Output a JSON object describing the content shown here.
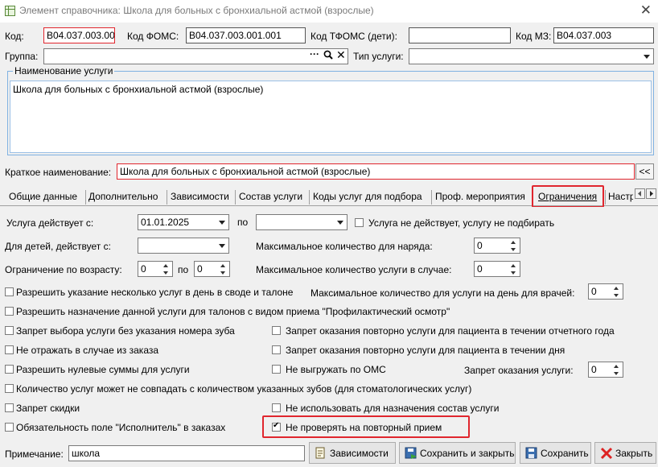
{
  "window": {
    "title": "Элемент справочника: Школа для больных с бронхиальной астмой (взрослые)"
  },
  "header": {
    "kod_label": "Код:",
    "kod_value": "B04.037.003.00",
    "foms_label": "Код ФОМС:",
    "foms_value": "B04.037.003.001.001",
    "tfoms_label": "Код ТФОМС (дети):",
    "tfoms_value": "",
    "mz_label": "Код МЗ:",
    "mz_value": "B04.037.003",
    "group_label": "Группа:",
    "group_value": "",
    "service_type_label": "Тип услуги:",
    "service_type_value": ""
  },
  "name_section": {
    "legend": "Наименование услуги",
    "value": "Школа для больных с бронхиальной астмой (взрослые)",
    "short_label": "Краткое наименование:",
    "short_value": "Школа для больных с бронхиальной астмой (взрослые)",
    "copy_button": "<<"
  },
  "tabs": [
    {
      "label": "Общие данные"
    },
    {
      "label": "Дополнительно"
    },
    {
      "label": "Зависимости"
    },
    {
      "label": "Состав услуги"
    },
    {
      "label": "Коды услуг для подбора"
    },
    {
      "label": "Проф. мероприятия"
    },
    {
      "label": "Ограничения"
    },
    {
      "label": "Настр"
    }
  ],
  "restrictions": {
    "valid_from_label": "Услуга действует с:",
    "valid_from_value": "01.01.2025",
    "valid_to_label": "по",
    "valid_to_value": "",
    "inactive_label": "Услуга не действует, услугу не подбирать",
    "children_from_label": "Для детей, действует с:",
    "children_from_value": "",
    "max_order_label": "Максимальное количество для наряда:",
    "max_order_value": "0",
    "age_label": "Ограничение по возрасту:",
    "age_from": "0",
    "age_to_label": "по",
    "age_to": "0",
    "max_case_label": "Максимальное количество услуги в случае:",
    "max_case_value": "0",
    "multi_per_day_label": "Разрешить указание несколько услуг в день в своде и талоне",
    "max_per_day_label": "Максимальное количество для услуги на день для врачей:",
    "max_per_day_value": "0",
    "allow_prof_label": "Разрешить назначение данной услуги для талонов с видом приема \"Профилактический осмотр\"",
    "no_tooth_label": "Запрет выбора услуги без указания номера зуба",
    "repeat_year_label": "Запрет оказания повторно услуги для пациента в течении отчетного года",
    "no_case_from_order_label": "Не отражать в случае из заказа",
    "repeat_day_label": "Запрет оказания повторно услуги для пациента в течении дня",
    "allow_zero_label": "Разрешить нулевые суммы для услуги",
    "no_oms_label": "Не выгружать по ОМС",
    "ban_label": "Запрет оказания услуги:",
    "ban_value": "0",
    "tooth_mismatch_label": "Количество услуг может не совпадать с количеством указанных зубов (для стоматологических услуг)",
    "no_discount_label": "Запрет скидки",
    "no_compose_label": "Не использовать для назначения состав услуги",
    "executor_required_label": "Обязательность поле \"Исполнитель\" в заказах",
    "no_repeat_check_label": "Не проверять на повторный прием"
  },
  "footer": {
    "note_label": "Примечание:",
    "note_value": "школа",
    "btn_deps": "Зависимости",
    "btn_save_close": "Сохранить и закрыть",
    "btn_save": "Сохранить",
    "btn_close": "Закрыть"
  },
  "colors": {
    "highlight": "#e0262e",
    "tab_active": "#1a1a1a"
  }
}
